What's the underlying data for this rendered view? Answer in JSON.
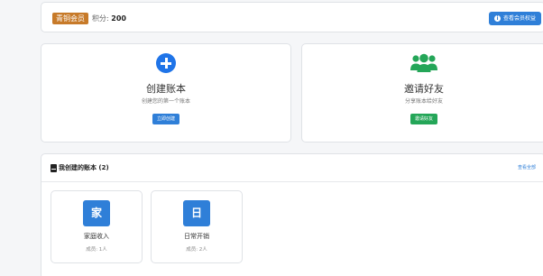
{
  "member": {
    "level": "青铜会员",
    "points_label": "积分: ",
    "points_value": "200",
    "benefits_button": "查看会员权益",
    "benefits_icon": "info-icon"
  },
  "actions": {
    "create": {
      "icon": "plus-circle-icon",
      "title": "创建账本",
      "subtitle": "创建您的第一个账本",
      "button": "立即创建"
    },
    "invite": {
      "icon": "users-icon",
      "title": "邀请好友",
      "subtitle": "分享账本给好友",
      "button": "邀请好友"
    }
  },
  "ledgers": {
    "title": "我创建的账本 (2)",
    "view_all": "查看全部",
    "items": [
      {
        "avatar": "家",
        "name": "家庭收入",
        "members": "成员: 1人"
      },
      {
        "avatar": "日",
        "name": "日常开销",
        "members": "成员: 2人"
      }
    ]
  },
  "colors": {
    "primary": "#2f7fd8",
    "success": "#24a658",
    "bronze": "#c77a29"
  }
}
